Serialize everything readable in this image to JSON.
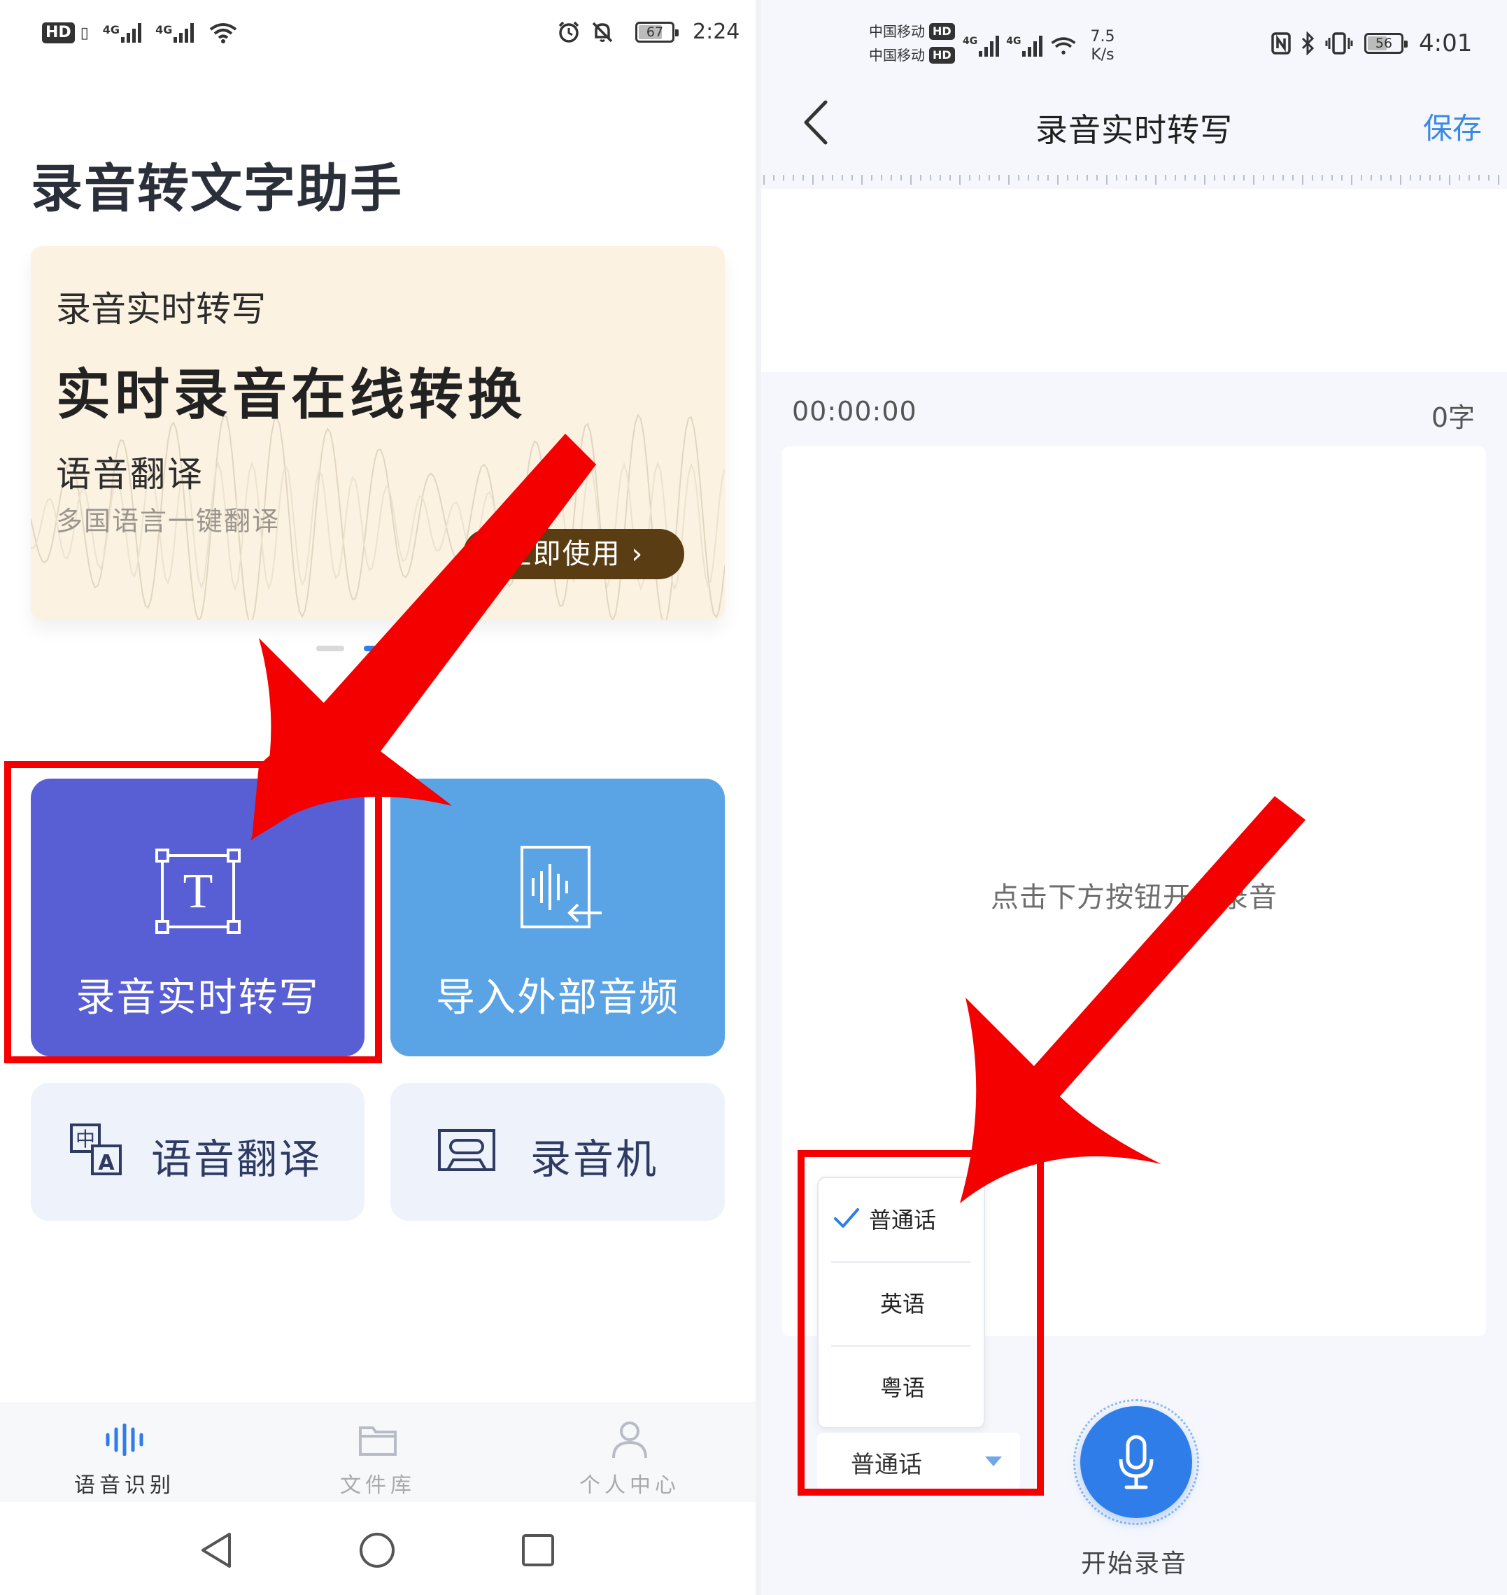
{
  "left": {
    "status_bar": {
      "hd_badge": "HD",
      "sim_icon": "▯",
      "network_1": "4G",
      "network_2": "4G",
      "battery": "67",
      "time": "2:24"
    },
    "app_title": "录音转文字助手",
    "banner": {
      "subtitle": "录音实时转写",
      "title": "实时录音在线转换",
      "feature": "语音翻译",
      "feature_desc": "多国语言一键翻译",
      "cta": "立即使用 ›",
      "active_dot_index": 1
    },
    "tiles": {
      "realtime_label": "录音实时转写",
      "import_label": "导入外部音频",
      "translate_label": "语音翻译",
      "recorder_label": "录音机",
      "translate_icon_top": "中",
      "translate_icon_bottom": "A"
    },
    "bottom_nav": {
      "items": [
        {
          "label": "语音识别",
          "active": true
        },
        {
          "label": "文件库",
          "active": false
        },
        {
          "label": "个人中心",
          "active": false
        }
      ]
    }
  },
  "right": {
    "status_bar": {
      "carrier_1": "中国移动",
      "carrier_2": "中国移动",
      "hd_badge": "HD",
      "network_1": "4G",
      "network_2": "4G",
      "speed_value": "7.5",
      "speed_unit": "K/s",
      "battery": "56",
      "time": "4:01"
    },
    "header": {
      "title": "录音实时转写",
      "save_label": "保存"
    },
    "timer": "00:00:00",
    "char_count": "0字",
    "hint": "点击下方按钮开始录音",
    "language": {
      "options": [
        "普通话",
        "英语",
        "粤语"
      ],
      "selected": "普通话"
    },
    "record_label": "开始录音"
  },
  "colors": {
    "annotation_red": "#f40000",
    "realtime_tile": "#585ed3",
    "import_tile": "#5aa3e5",
    "banner_bg": "#fbf2e2",
    "banner_button": "#5a3d12",
    "accent_blue": "#2f7de8"
  }
}
